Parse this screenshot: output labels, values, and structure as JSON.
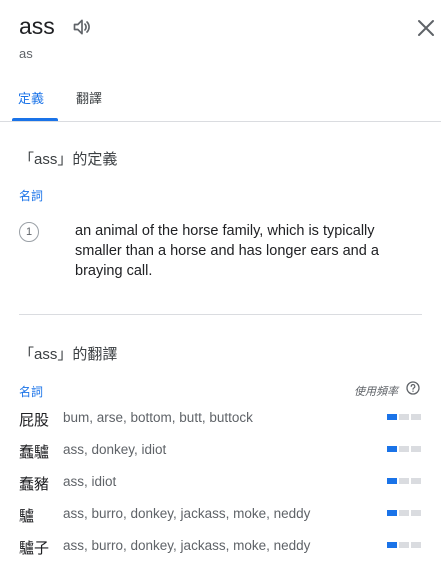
{
  "header": {
    "word": "ass",
    "phonetic": "as",
    "speaker_icon": "speaker-icon",
    "close_icon": "close-icon"
  },
  "tabs": [
    {
      "label": "定義",
      "active": true
    },
    {
      "label": "翻譯",
      "active": false
    }
  ],
  "definitions": {
    "title": "「ass」的定義",
    "pos": "名詞",
    "senses": [
      {
        "num": "1",
        "text": "an animal of the horse family, which is typically smaller than a horse and has longer ears and a braying call."
      }
    ]
  },
  "translations": {
    "title": "「ass」的翻譯",
    "pos": "名詞",
    "freq_label": "使用頻率",
    "help_icon": "help-circle-icon",
    "accent": "#1a73e8",
    "rows": [
      {
        "word": "屁股",
        "synonyms": "bum, arse, bottom, butt, buttock",
        "frequency": 1
      },
      {
        "word": "蠢驢",
        "synonyms": "ass, donkey, idiot",
        "frequency": 1
      },
      {
        "word": "蠢豬",
        "synonyms": "ass, idiot",
        "frequency": 1
      },
      {
        "word": "驢",
        "synonyms": "ass, burro, donkey, jackass, moke, neddy",
        "frequency": 1
      },
      {
        "word": "驢子",
        "synonyms": "ass, burro, donkey, jackass, moke, neddy",
        "frequency": 1
      }
    ]
  }
}
